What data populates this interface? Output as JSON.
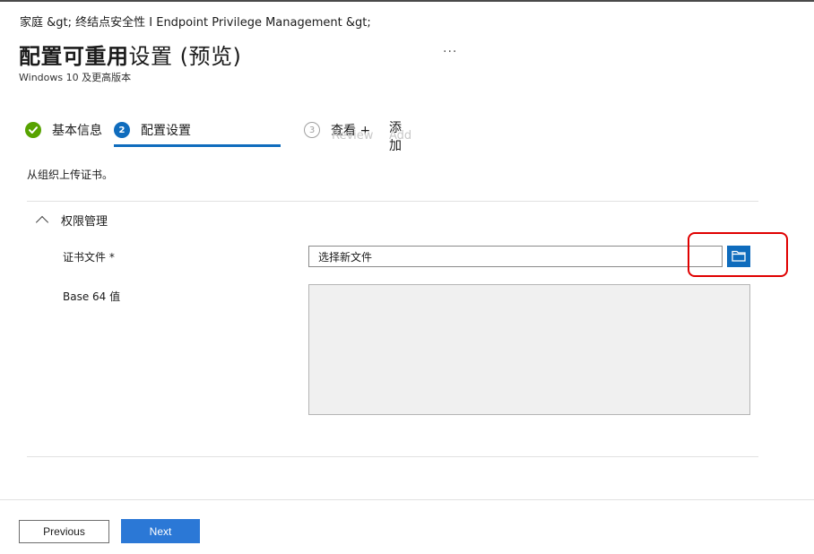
{
  "breadcrumb": "家庭 &gt;  终结点安全性 I Endpoint Privilege Management &gt;",
  "title": {
    "bold": "配置可重用",
    "normal": "设置 (预览)"
  },
  "more_label": "···",
  "subtitle": "Windows 10 及更高版本",
  "steps": [
    {
      "number": "✓",
      "label": "基本信息",
      "state": "done"
    },
    {
      "number": "2",
      "label": "配置设置",
      "state": "active"
    },
    {
      "number": "3",
      "label": "查看 +",
      "state": "inactive"
    }
  ],
  "step_extra": {
    "add_label": "添加",
    "ghost_review": "Review",
    "ghost_add": "Add"
  },
  "intro_text": "从组织上传证书。",
  "section": {
    "label": "权限管理"
  },
  "fields": {
    "cert_file_label": "证书文件 *",
    "cert_file_value": "选择新文件",
    "base64_label": "Base 64 值",
    "base64_value": ""
  },
  "footer": {
    "previous_label": "Previous",
    "next_label": "Next"
  },
  "colors": {
    "accent": "#0f6cbd",
    "success": "#57a300",
    "highlight": "#e00000"
  }
}
